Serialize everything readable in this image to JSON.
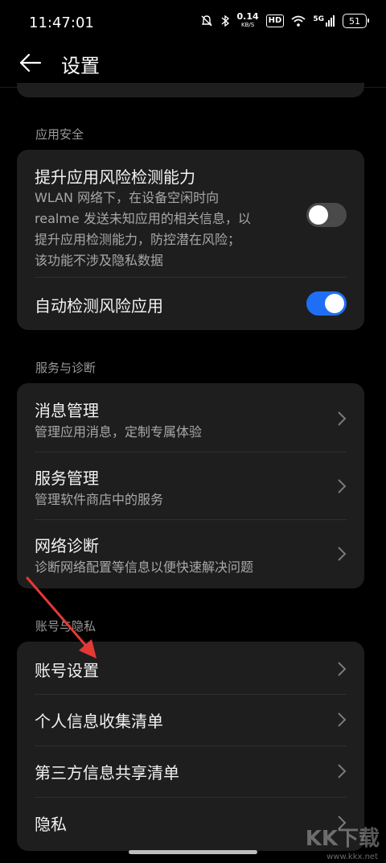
{
  "status_bar": {
    "time": "11:47:01",
    "net_speed_value": "0.14",
    "net_speed_unit": "KB/S",
    "hd_badge": "HD",
    "network": "5G",
    "battery": "51"
  },
  "header": {
    "title": "设置"
  },
  "sections": {
    "app_security": {
      "label": "应用安全",
      "risk_detection_title": "提升应用风险检测能力",
      "risk_detection_desc": [
        "WLAN 网络下，在设备空闲时向",
        "realme 发送未知应用的相关信息，以",
        "提升应用检测能力，防控潜在风险；",
        "该功能不涉及隐私数据"
      ],
      "risk_detection_enabled": false,
      "auto_detect_title": "自动检测风险应用",
      "auto_detect_enabled": true
    },
    "service_diag": {
      "label": "服务与诊断",
      "items": [
        {
          "title": "消息管理",
          "sub": "管理应用消息，定制专属体验"
        },
        {
          "title": "服务管理",
          "sub": "管理软件商店中的服务"
        },
        {
          "title": "网络诊断",
          "sub": "诊断网络配置等信息以便快速解决问题"
        }
      ]
    },
    "account_privacy": {
      "label": "账号与隐私",
      "items": [
        {
          "title": "账号设置"
        },
        {
          "title": "个人信息收集清单"
        },
        {
          "title": "第三方信息共享清单"
        },
        {
          "title": "隐私"
        }
      ]
    }
  },
  "watermark": {
    "text": "KK下载",
    "url": "www.kkx.net"
  },
  "colors": {
    "background": "#000000",
    "card": "#1e1e1e",
    "accent": "#1e6ff5",
    "annotation_arrow": "#e53935"
  }
}
